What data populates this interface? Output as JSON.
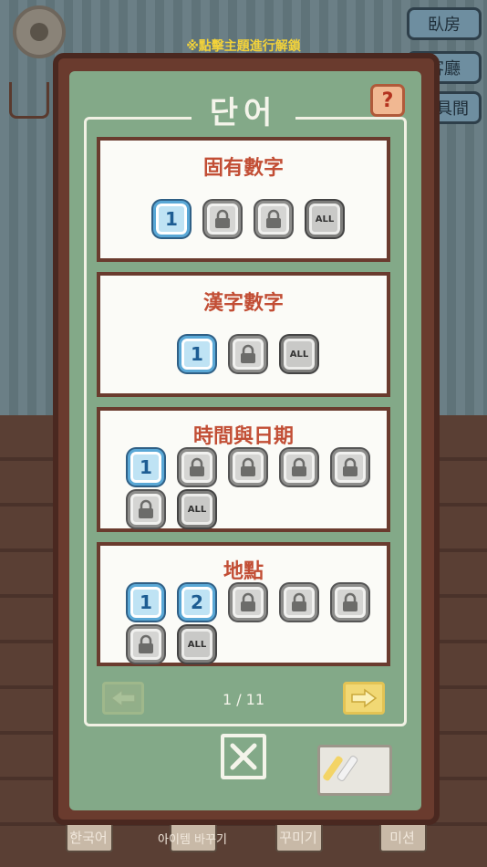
{
  "hint": "※點擊主題進行解鎖",
  "side_buttons": [
    "臥房",
    "客廳",
    "工具間"
  ],
  "board": {
    "title": "단어",
    "help_label": "?",
    "page_indicator": "1 / 11"
  },
  "categories": [
    {
      "title": "固有數字",
      "levels": [
        "1",
        "lock",
        "lock",
        "ALL"
      ]
    },
    {
      "title": "漢字數字",
      "levels": [
        "1",
        "lock",
        "ALL"
      ]
    },
    {
      "title": "時間與日期",
      "levels": [
        "1",
        "lock",
        "lock",
        "lock",
        "lock",
        "lock",
        "ALL"
      ]
    },
    {
      "title": "地點",
      "levels": [
        "1",
        "2",
        "lock",
        "lock",
        "lock",
        "lock",
        "ALL"
      ]
    }
  ],
  "bottom_nav": [
    {
      "label": "한국어"
    },
    {
      "label": "아이템 바꾸기"
    },
    {
      "label": "꾸미기"
    },
    {
      "label": "미션"
    }
  ],
  "icons": {
    "level_lock": "lock-icon",
    "prev_page": "arrow-left-icon",
    "next_page": "arrow-right-icon",
    "close": "close-icon",
    "settings": "gear-icon",
    "shop": "cart-icon"
  },
  "colors": {
    "board_green": "#83a988",
    "frame_brown": "#6a3b2e",
    "title_red": "#c24e35",
    "level_blue": "#5aa8d6",
    "hint_yellow": "#f2d23a"
  }
}
